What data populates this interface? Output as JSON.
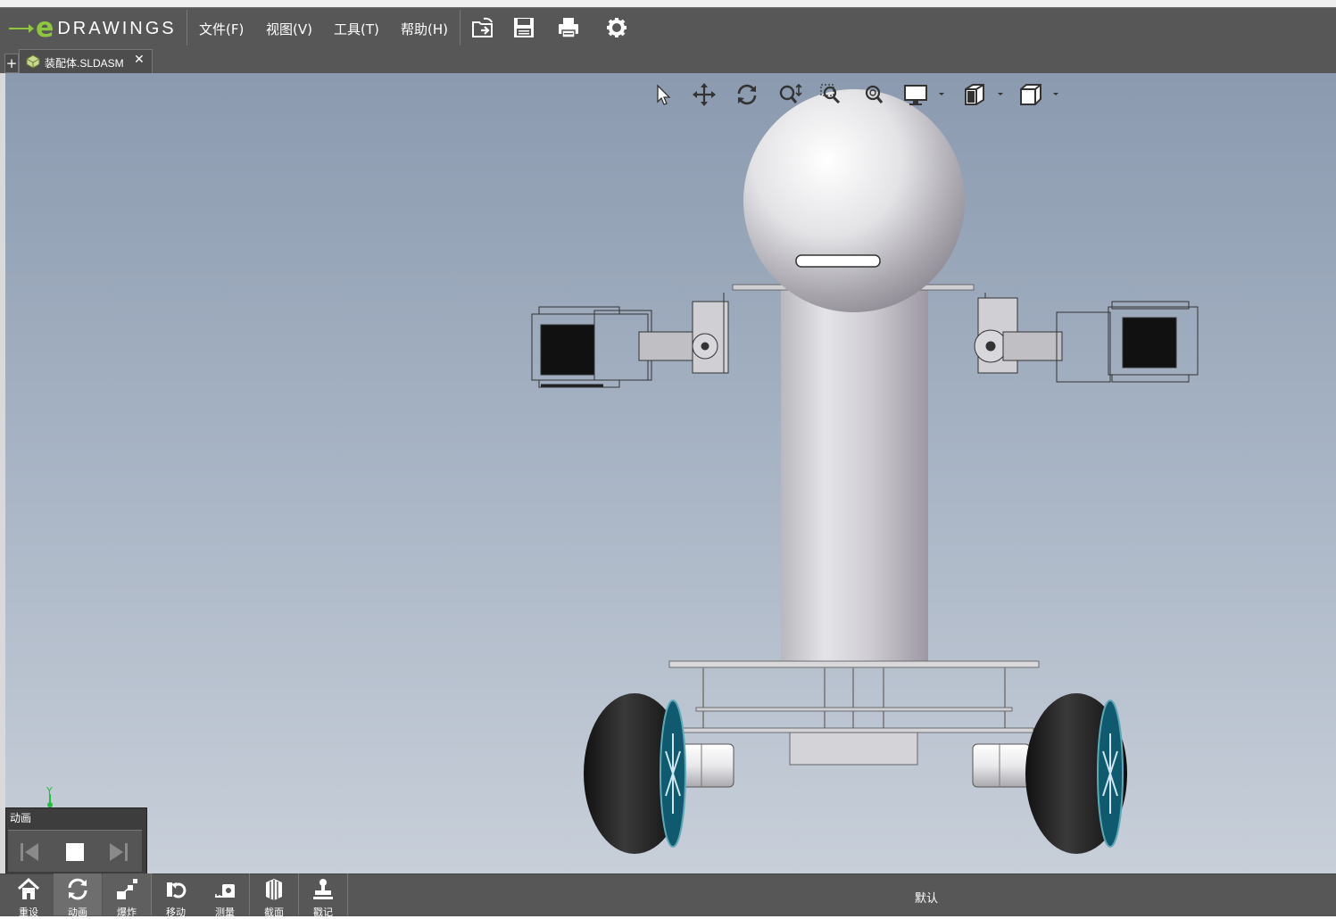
{
  "app": {
    "logo_text": "DRAWINGS"
  },
  "menu": {
    "file": "文件(F)",
    "view": "视图(V)",
    "tools": "工具(T)",
    "help": "帮助(H)"
  },
  "toolbar_icons": [
    "open-icon",
    "save-icon",
    "print-icon",
    "settings-icon"
  ],
  "tab": {
    "plus": "+",
    "document_name": "装配体.SLDASM",
    "close": "✕"
  },
  "view_tools": [
    "select-icon",
    "pan-icon",
    "rotate-icon",
    "zoom-icon",
    "zoom-to-area-icon",
    "zoom-to-fit-icon",
    "display-style-icon",
    "view-orientation-icon",
    "standard-views-icon"
  ],
  "axis": {
    "y_label": "Y"
  },
  "animation": {
    "title": "动画"
  },
  "bottom_tools": [
    {
      "label": "重设",
      "icon": "home-icon"
    },
    {
      "label": "动画",
      "icon": "animate-icon"
    },
    {
      "label": "爆炸",
      "icon": "explode-icon"
    },
    {
      "label": "移动",
      "icon": "move-icon"
    },
    {
      "label": "测量",
      "icon": "measure-icon"
    },
    {
      "label": "截面",
      "icon": "section-icon"
    },
    {
      "label": "戳记",
      "icon": "stamp-icon"
    }
  ],
  "config": {
    "name": "默认"
  },
  "colors": {
    "chrome": "#575757",
    "accent": "#8dc63f",
    "wheel_hub": "#0f5a6e"
  }
}
